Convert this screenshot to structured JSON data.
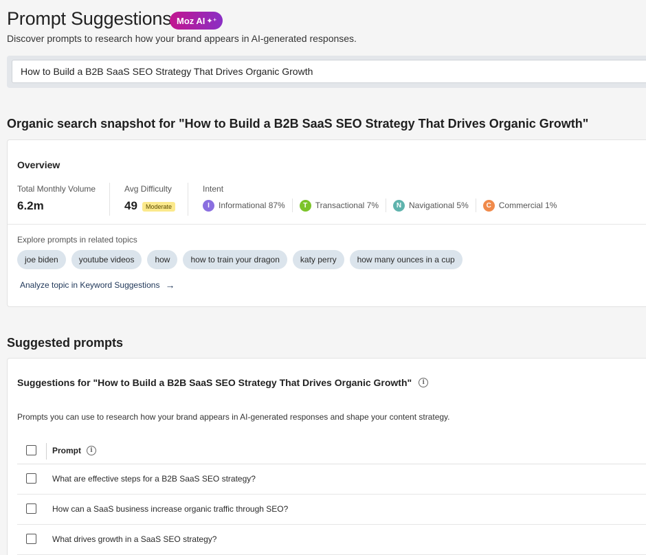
{
  "header": {
    "title": "Prompt Suggestions",
    "badge": "Moz AI",
    "badge_icon": "sparkle-icon",
    "subtitle": "Discover prompts to research how your brand appears in AI-generated responses."
  },
  "search": {
    "value": "How to Build a B2B SaaS SEO Strategy That Drives Organic Growth"
  },
  "snapshot": {
    "heading": "Organic search snapshot for \"How to Build a B2B SaaS SEO Strategy That Drives Organic Growth\"",
    "overview": {
      "title": "Overview",
      "volume_label": "Total Monthly Volume",
      "volume_value": "6.2m",
      "difficulty_label": "Avg Difficulty",
      "difficulty_value": "49",
      "difficulty_badge": "Moderate",
      "intent_label": "Intent",
      "intents": [
        {
          "letter": "I",
          "label": "Informational 87%",
          "color": "#8a6fe0"
        },
        {
          "letter": "T",
          "label": "Transactional 7%",
          "color": "#7cc42a"
        },
        {
          "letter": "N",
          "label": "Navigational 5%",
          "color": "#5fb3ad"
        },
        {
          "letter": "C",
          "label": "Commercial 1%",
          "color": "#f08a4b"
        }
      ]
    },
    "related_label": "Explore prompts in related topics",
    "related_topics": [
      "joe biden",
      "youtube videos",
      "how",
      "how to train your dragon",
      "katy perry",
      "how many ounces in a cup"
    ],
    "analyze_link": "Analyze topic in Keyword Suggestions"
  },
  "suggested": {
    "heading": "Suggested prompts",
    "card_title": "Suggestions for \"How to Build a B2B SaaS SEO Strategy That Drives Organic Growth\"",
    "description": "Prompts you can use to research how your brand appears in AI-generated responses and shape your content strategy.",
    "column_prompt": "Prompt",
    "rows": [
      "What are effective steps for a B2B SaaS SEO strategy?",
      "How can a SaaS business increase organic traffic through SEO?",
      "What drives growth in a SaaS SEO strategy?"
    ]
  }
}
